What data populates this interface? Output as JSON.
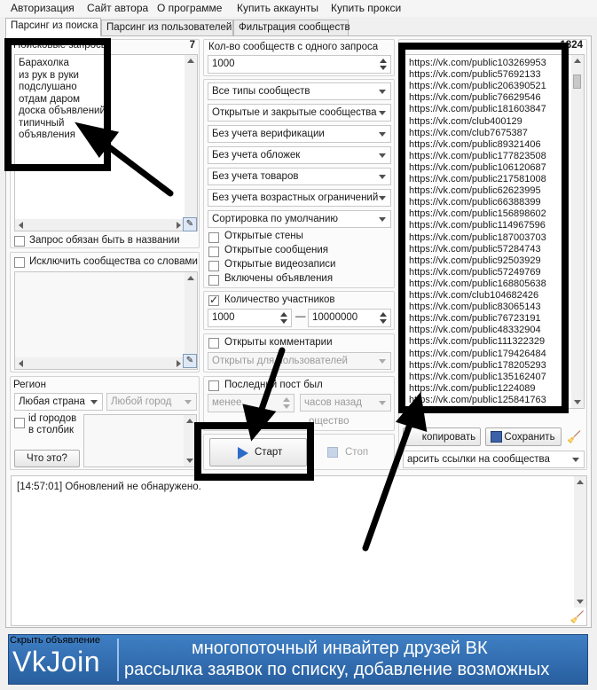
{
  "menu": [
    "Авторизация",
    "Сайт автора",
    "О программе",
    "Купить аккаунты",
    "Купить прокси"
  ],
  "tabs": [
    "Парсинг из поиска",
    "Парсинг из пользователей",
    "Фильтрация сообществ"
  ],
  "search_queries": {
    "label": "Поисковые запросы",
    "count": "7",
    "lines": [
      "Барахолка",
      "из рук в руки",
      "подслушано",
      "отдам даром",
      "доска объявлений",
      "типичный",
      "объявления"
    ]
  },
  "name_required": {
    "label": "Запрос обязан быть в названии",
    "checked": false
  },
  "exclude_words": {
    "label": "Исключить сообщества со словами",
    "checked": false
  },
  "region": {
    "label": "Регион",
    "country": "Любая страна",
    "city": "Любой город",
    "city_ids_label_1": "id городов",
    "city_ids_label_2": "в столбик",
    "what_is_this": "Что это?"
  },
  "communities_per_query": {
    "label": "Кол-во сообществ с одного запроса",
    "value": "1000"
  },
  "filters": [
    "Все типы сообществ",
    "Открытые и закрытые сообщества",
    "Без учета верификации",
    "Без учета обложек",
    "Без учета товаров",
    "Без учета возрастных ограничений",
    "Сортировка по умолчанию"
  ],
  "check_options": [
    {
      "label": "Открытые стены",
      "checked": false
    },
    {
      "label": "Открытые сообщения",
      "checked": false
    },
    {
      "label": "Открытые видеозаписи",
      "checked": false
    },
    {
      "label": "Включены объявления",
      "checked": false
    }
  ],
  "members": {
    "label": "Количество участников",
    "checked": true,
    "min": "1000",
    "dash": "—",
    "max": "10000000"
  },
  "comments": {
    "label": "Открыты комментарии",
    "checked": false,
    "select": "Открыты для пользователей"
  },
  "last_post": {
    "label": "Последний пост был",
    "checked": false,
    "less": "менее",
    "unit": "часов назад",
    "partial": "ощество"
  },
  "buttons": {
    "start": "Старт",
    "stop": "Стоп",
    "copy": "копировать",
    "save": "Сохранить"
  },
  "results": {
    "count": "1824",
    "links": [
      "https://vk.com/public103269953",
      "https://vk.com/public57692133",
      "https://vk.com/public206390521",
      "https://vk.com/public76629546",
      "https://vk.com/public181603847",
      "https://vk.com/club400129",
      "https://vk.com/club7675387",
      "https://vk.com/public89321406",
      "https://vk.com/public177823508",
      "https://vk.com/public106120687",
      "https://vk.com/public217581008",
      "https://vk.com/public62623995",
      "https://vk.com/public66388399",
      "https://vk.com/public156898602",
      "https://vk.com/public114967596",
      "https://vk.com/public187003703",
      "https://vk.com/public57284743",
      "https://vk.com/public92503929",
      "https://vk.com/public57249769",
      "https://vk.com/public168805638",
      "https://vk.com/club104682426",
      "https://vk.com/public83065143",
      "https://vk.com/public76723191",
      "https://vk.com/public48332904",
      "https://vk.com/public111322329",
      "https://vk.com/public179426484",
      "https://vk.com/public178205293",
      "https://vk.com/public135162407",
      "https://vk.com/public1224089",
      "https://vk.com/public125841763"
    ],
    "mode": "арсить ссылки на сообщества"
  },
  "log": {
    "lines": [
      "[14:57:01] Обновлений не обнаружено."
    ]
  },
  "banner": {
    "hint": "Скрыть объявление",
    "logo": "VkJoin",
    "line1": "многопоточный инвайтер друзей ВК",
    "line2": "рассылка заявок по списку, добавление возможных"
  }
}
